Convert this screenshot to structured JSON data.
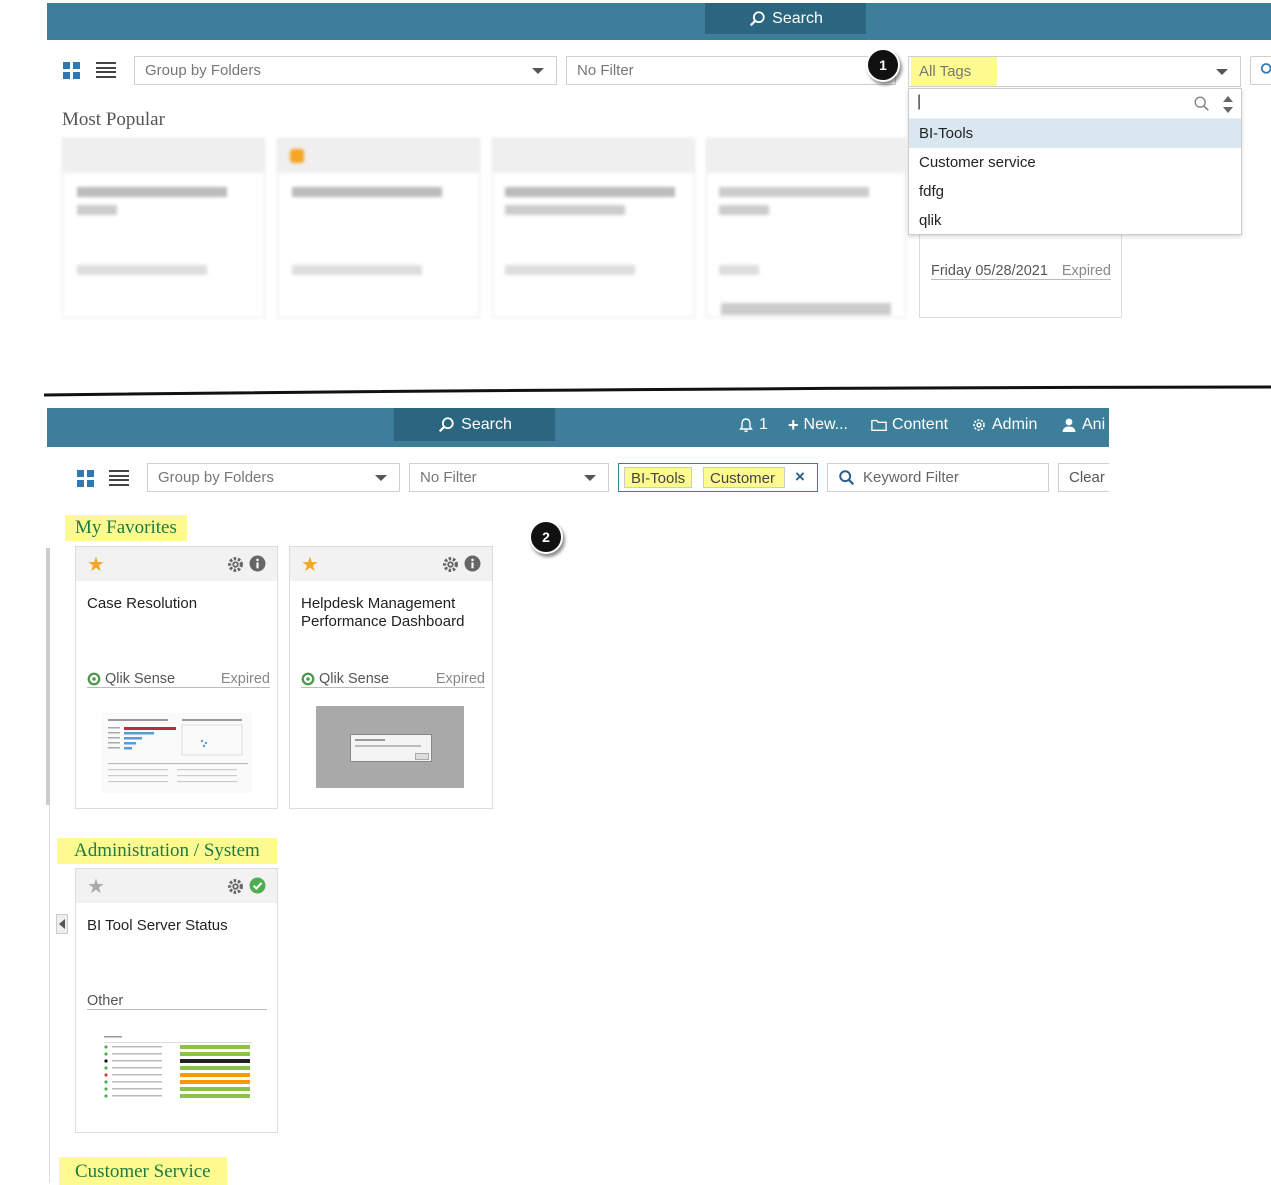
{
  "top": {
    "search_label": "Search",
    "toolbar": {
      "group_by": "Group by Folders",
      "filter": "No Filter",
      "tags": "All Tags"
    },
    "badge": "1",
    "section_title": "Most Popular",
    "dropdown": {
      "search_value": "|",
      "options": [
        "BI-Tools",
        "Customer service",
        "fdfg",
        "qlik"
      ]
    },
    "visible_card_meta": {
      "date": "Friday 05/28/2021",
      "status": "Expired"
    }
  },
  "bottom": {
    "nav": {
      "search_label": "Search",
      "notifications": "1",
      "new_label": "New...",
      "content_label": "Content",
      "admin_label": "Admin",
      "user_label": "Ani"
    },
    "toolbar": {
      "group_by": "Group by Folders",
      "filter": "No Filter",
      "tags": [
        "BI-Tools",
        "Customer"
      ],
      "keyword_placeholder": "Keyword Filter",
      "clear_label": "Clear"
    },
    "badge": "2",
    "sections": [
      {
        "title": "My Favorites",
        "cards": [
          {
            "title": "Case Resolution",
            "source": "Qlik Sense",
            "status": "Expired",
            "favorite": true
          },
          {
            "title": "Helpdesk Management Performance Dashboard",
            "source": "Qlik Sense",
            "status": "Expired",
            "favorite": true
          }
        ]
      },
      {
        "title": "Administration / System",
        "cards": [
          {
            "title": "BI Tool Server Status",
            "source": "Other",
            "status": "",
            "favorite": false
          }
        ]
      },
      {
        "title": "Customer Service",
        "cards": []
      }
    ]
  },
  "colors": {
    "topbar": "#3d7e9a",
    "search_button": "#2c6580",
    "highlight": "#fdfb8f",
    "accent_blue": "#2d79b5",
    "star": "#f5a623",
    "check_green": "#4caf50"
  }
}
